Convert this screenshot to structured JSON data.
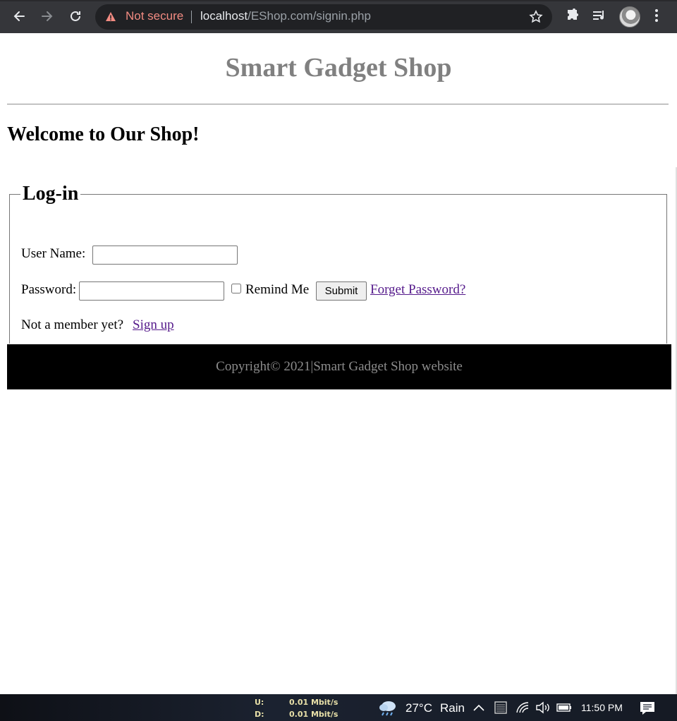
{
  "browser": {
    "security_label": "Not secure",
    "url_host": "localhost",
    "url_path": "/EShop.com/signin.php"
  },
  "page": {
    "site_title": "Smart Gadget Shop",
    "welcome_heading": "Welcome to Our Shop!",
    "login_form": {
      "legend": "Log-in",
      "username_label": "User Name:",
      "username_value": "",
      "password_label": "Password:",
      "password_value": "",
      "remind_me_label": "Remind Me",
      "submit_label": "Submit",
      "forgot_password_link": "Forget Password?",
      "not_member_text": "Not a member yet?",
      "signup_link": "Sign up"
    },
    "footer_text": "Copyright© 2021|Smart Gadget Shop website"
  },
  "taskbar": {
    "upload_label": "U:",
    "upload_value": "0.01 Mbit/s",
    "download_label": "D:",
    "download_value": "0.01 Mbit/s",
    "temperature": "27°C",
    "weather": "Rain",
    "time": "11:50 PM"
  }
}
